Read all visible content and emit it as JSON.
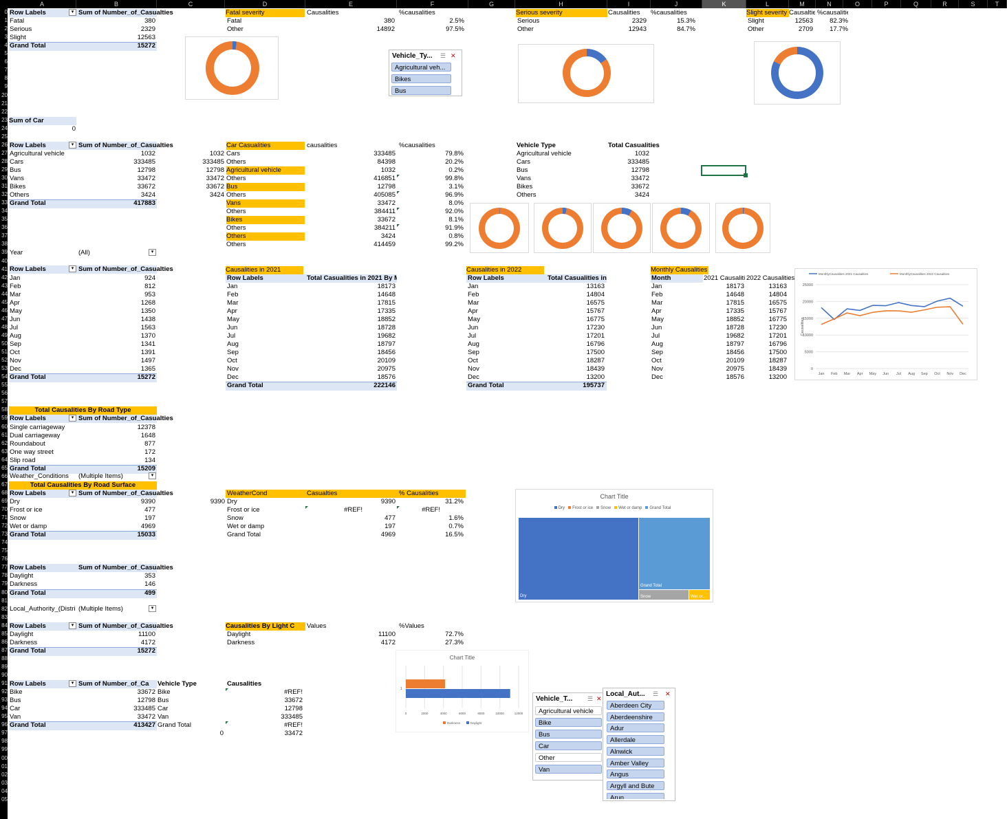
{
  "columns": [
    "A",
    "B",
    "C",
    "D",
    "E",
    "F",
    "G",
    "H",
    "I",
    "J",
    "K",
    "L",
    "M",
    "N",
    "O",
    "P",
    "Q",
    "R",
    "S",
    "T"
  ],
  "selected_column": "K",
  "row_numbers": [
    "0",
    "1",
    "2",
    "3",
    "4",
    "5",
    "6",
    "7",
    "8",
    "9",
    "20",
    "21",
    "22",
    "23",
    "24",
    "25",
    "26",
    "27",
    "28",
    "29",
    "30",
    "31",
    "32",
    "33",
    "34",
    "35",
    "36",
    "37",
    "38",
    "39",
    "40",
    "41",
    "42",
    "43",
    "44",
    "45",
    "46",
    "47",
    "48",
    "49",
    "50",
    "51",
    "52",
    "53",
    "54",
    "55",
    "56",
    "57",
    "58",
    "59",
    "60",
    "61",
    "62",
    "63",
    "64",
    "65",
    "66",
    "67",
    "68",
    "69",
    "70",
    "71",
    "72",
    "73",
    "74",
    "75",
    "76",
    "77",
    "78",
    "79",
    "80",
    "81",
    "82",
    "83",
    "84",
    "85",
    "86",
    "87",
    "88",
    "89",
    "90",
    "91",
    "92",
    "93",
    "94",
    "95",
    "96",
    "97",
    "98",
    "99",
    "00",
    "01",
    "02",
    "03",
    "04",
    "05"
  ],
  "severity_pivot": {
    "h1": "Row Labels",
    "h2": "Sum of Number_of_Casualties",
    "rows": [
      [
        "Fatal",
        "380"
      ],
      [
        "Serious",
        "2329"
      ],
      [
        "Slight",
        "12563"
      ]
    ],
    "total": [
      "Grand Total",
      "15272"
    ]
  },
  "fatal": {
    "h": [
      "Fatal severity",
      "Causalities",
      "%causalities"
    ],
    "rows": [
      [
        "Fatal",
        "380",
        "2.5%"
      ],
      [
        "Other",
        "14892",
        "97.5%"
      ]
    ]
  },
  "serious": {
    "h": [
      "Serious severity",
      "Causalities",
      "%causalities"
    ],
    "rows": [
      [
        "Serious",
        "2329",
        "15.3%"
      ],
      [
        "Other",
        "12943",
        "84.7%"
      ]
    ]
  },
  "slight": {
    "h": [
      "Slight severity",
      "Causaltie",
      "%causalities"
    ],
    "rows": [
      [
        "Slight",
        "12563",
        "82.3%"
      ],
      [
        "Other",
        "2709",
        "17.7%"
      ]
    ]
  },
  "sum_car": {
    "label": "Sum of Car",
    "value": "0"
  },
  "vehicle_pivot": {
    "h1": "Row Labels",
    "h2": "Sum of Number_of_Casualties",
    "rows": [
      [
        "Agricultural vehicle",
        "1032"
      ],
      [
        "Cars",
        "333485"
      ],
      [
        "Bus",
        "12798"
      ],
      [
        "Vans",
        "33472"
      ],
      [
        "Bikes",
        "33672"
      ],
      [
        "Others",
        "3424"
      ]
    ],
    "total": [
      "Grand Total",
      "417883"
    ]
  },
  "colC_values": [
    "1032",
    "333485",
    "12798",
    "33472",
    "33672",
    "3424"
  ],
  "car_casualties": {
    "h": [
      "Car Casualities",
      "causalities",
      "%causalities"
    ],
    "rows": [
      [
        "Cars",
        "333485",
        "79.8%"
      ],
      [
        "Others",
        "84398",
        "20.2%"
      ],
      [
        "Agricultural vehicle",
        "1032",
        "0.2%"
      ],
      [
        "Others",
        "416851",
        "99.8%"
      ],
      [
        "Bus",
        "12798",
        "3.1%"
      ],
      [
        "Others",
        "405085",
        "96.9%"
      ],
      [
        "Vans",
        "33472",
        "8.0%"
      ],
      [
        "Others",
        "384411",
        "92.0%"
      ],
      [
        "Bikes",
        "33672",
        "8.1%"
      ],
      [
        "Others",
        "384211",
        "91.9%"
      ],
      [
        "Others",
        "3424",
        "0.8%"
      ],
      [
        "Others",
        "414459",
        "99.2%"
      ]
    ]
  },
  "vehicle_type_table": {
    "h": [
      "Vehicle Type",
      "Total Casualities"
    ],
    "rows": [
      [
        "Agricultural vehicle",
        "1032"
      ],
      [
        "Cars",
        "333485"
      ],
      [
        "Bus",
        "12798"
      ],
      [
        "Vans",
        "33472"
      ],
      [
        "Bikes",
        "33672"
      ],
      [
        "Others",
        "3424"
      ]
    ]
  },
  "donut_pcts": {
    "fatal": 2.5,
    "serious": 15.3,
    "slight": 82.3,
    "v1": 0.2,
    "v2": 3.1,
    "v3": 8.0,
    "v4": 8.1,
    "v5": 0.8
  },
  "year_filter": {
    "label": "Year",
    "value": "(All)"
  },
  "month_pivot": {
    "h1": "Row Labels",
    "h2": "Sum of Number_of_Casualties",
    "rows": [
      [
        "Jan",
        "924"
      ],
      [
        "Feb",
        "812"
      ],
      [
        "Mar",
        "953"
      ],
      [
        "Apr",
        "1268"
      ],
      [
        "May",
        "1350"
      ],
      [
        "Jun",
        "1438"
      ],
      [
        "Jul",
        "1563"
      ],
      [
        "Aug",
        "1370"
      ],
      [
        "Sep",
        "1341"
      ],
      [
        "Oct",
        "1391"
      ],
      [
        "Nov",
        "1497"
      ],
      [
        "Dec",
        "1365"
      ]
    ],
    "total": [
      "Grand Total",
      "15272"
    ]
  },
  "cas2021": {
    "title": "Causalities in 2021",
    "h1": "Row Labels",
    "h2": "Total Casualities in 2021 By Month",
    "rows": [
      [
        "Jan",
        "18173"
      ],
      [
        "Feb",
        "14648"
      ],
      [
        "Mar",
        "17815"
      ],
      [
        "Apr",
        "17335"
      ],
      [
        "May",
        "18852"
      ],
      [
        "Jun",
        "18728"
      ],
      [
        "Jul",
        "19682"
      ],
      [
        "Aug",
        "18797"
      ],
      [
        "Sep",
        "18456"
      ],
      [
        "Oct",
        "20109"
      ],
      [
        "Nov",
        "20975"
      ],
      [
        "Dec",
        "18576"
      ]
    ],
    "total": [
      "Grand Total",
      "222146"
    ]
  },
  "cas2022": {
    "title": "Causalities in 2022",
    "h1": "Row Labels",
    "h2": "Total Casualities in 2022 By Month",
    "rows": [
      [
        "Jan",
        "13163"
      ],
      [
        "Feb",
        "14804"
      ],
      [
        "Mar",
        "16575"
      ],
      [
        "Apr",
        "15767"
      ],
      [
        "May",
        "16775"
      ],
      [
        "Jun",
        "17230"
      ],
      [
        "Jul",
        "17201"
      ],
      [
        "Aug",
        "16796"
      ],
      [
        "Sep",
        "17500"
      ],
      [
        "Oct",
        "18287"
      ],
      [
        "Nov",
        "18439"
      ],
      [
        "Dec",
        "13200"
      ]
    ],
    "total": [
      "Grand Total",
      "195737"
    ]
  },
  "monthly": {
    "title": "Monthly Causalities",
    "h": [
      "Month",
      "2021 Causaliti",
      "2022 Causalities"
    ],
    "rows": [
      [
        "Jan",
        "18173",
        "13163"
      ],
      [
        "Feb",
        "14648",
        "14804"
      ],
      [
        "Mar",
        "17815",
        "16575"
      ],
      [
        "Apr",
        "17335",
        "15767"
      ],
      [
        "May",
        "18852",
        "16775"
      ],
      [
        "Jun",
        "18728",
        "17230"
      ],
      [
        "Jul",
        "19682",
        "17201"
      ],
      [
        "Aug",
        "18797",
        "16796"
      ],
      [
        "Sep",
        "18456",
        "17500"
      ],
      [
        "Oct",
        "20109",
        "18287"
      ],
      [
        "Nov",
        "20975",
        "18439"
      ],
      [
        "Dec",
        "18576",
        "13200"
      ]
    ]
  },
  "road_type": {
    "title": "Total Causalities By Road Type",
    "h1": "Row Labels",
    "h2": "Sum of Number_of_Casualties",
    "rows": [
      [
        "Single carriageway",
        "12378"
      ],
      [
        "Dual carriageway",
        "1648"
      ],
      [
        "Roundabout",
        "877"
      ],
      [
        "One way street",
        "172"
      ],
      [
        "Slip road",
        "134"
      ]
    ],
    "total": [
      "Grand Total",
      "15209"
    ]
  },
  "weather_filter": {
    "label": "Weather_Conditions",
    "value": "(Multiple Items)"
  },
  "road_surface": {
    "title": "Total Causalities By Road Surface",
    "h1": "Row Labels",
    "h2": "Sum of Number_of_Casualties",
    "rows": [
      [
        "Dry",
        "9390"
      ],
      [
        "Frost or ice",
        "477"
      ],
      [
        "Snow",
        "197"
      ],
      [
        "Wet or damp",
        "4969"
      ]
    ],
    "total": [
      "Grand Total",
      "15033"
    ]
  },
  "colC_dry": "9390",
  "weather_table": {
    "h": [
      "WeatherCond",
      "Casualties",
      "% Causalities"
    ],
    "rows": [
      [
        "Dry",
        "9390",
        "31.2%"
      ],
      [
        "Frost or ice",
        "#REF!",
        "#REF!"
      ],
      [
        "Snow",
        "477",
        "1.6%"
      ],
      [
        "Wet or damp",
        "197",
        "0.7%"
      ],
      [
        "Grand Total",
        "4969",
        "16.5%"
      ]
    ]
  },
  "light_pivot1": {
    "h1": "Row Labels",
    "h2": "Sum of Number_of_Casualties",
    "rows": [
      [
        "Daylight",
        "353"
      ],
      [
        "Darkness",
        "146"
      ]
    ],
    "total": [
      "Grand Total",
      "499"
    ]
  },
  "local_filter": {
    "label": "Local_Authority_(Distri",
    "value": "(Multiple Items)"
  },
  "light_pivot2": {
    "h1": "Row Labels",
    "h2": "Sum of Number_of_Casualties",
    "rows": [
      [
        "Daylight",
        "11100"
      ],
      [
        "Darkness",
        "4172"
      ]
    ],
    "total": [
      "Grand Total",
      "15272"
    ]
  },
  "light_table": {
    "h": [
      "Causalities By Light C",
      "Values",
      "%Values"
    ],
    "rows": [
      [
        "Daylight",
        "11100",
        "72.7%"
      ],
      [
        "Darkness",
        "4172",
        "27.3%"
      ]
    ]
  },
  "veh_pivot2": {
    "h1": "Row Labels",
    "h2": "Sum of Number_of_Ca",
    "rows": [
      [
        "Bike",
        "33672"
      ],
      [
        "Bus",
        "12798"
      ],
      [
        "Car",
        "333485"
      ],
      [
        "Van",
        "33472"
      ]
    ],
    "total": [
      "Grand Total",
      "413427"
    ]
  },
  "veh_col_c": {
    "h": "Vehicle Type",
    "rows": [
      "Bike",
      "Bus",
      "Car",
      "Van",
      "Grand Total"
    ]
  },
  "veh_col_d": {
    "h": "Causalities",
    "rows": [
      "#REF!",
      "33672",
      "12798",
      "333485",
      "#REF!",
      "33472"
    ]
  },
  "zero_cell": "0",
  "slicer_vehicle_top": {
    "title": "Vehicle_Ty...",
    "items": [
      "Agricultural veh...",
      "Bikes",
      "Bus"
    ]
  },
  "slicer_vehicle": {
    "title": "Vehicle_T...",
    "items": [
      "Agricultural vehicle",
      "Bike",
      "Bus",
      "Car",
      "Other",
      "Van"
    ],
    "selected": [
      false,
      true,
      true,
      true,
      false,
      true
    ]
  },
  "slicer_local": {
    "title": "Local_Aut...",
    "items": [
      "Aberdeen City",
      "Aberdeenshire",
      "Adur",
      "Allerdale",
      "Alnwick",
      "Amber Valley",
      "Angus",
      "Argyll and Bute",
      "Arun"
    ]
  },
  "line_chart": {
    "legend": [
      "MonthlyCausalities 2021 Causalities",
      "MonthlyCausalities 2022 Causalities"
    ],
    "ylabel": "Causalities",
    "yticks": [
      "25000",
      "20000",
      "15000",
      "10000",
      "5000",
      "0"
    ]
  },
  "treemap": {
    "title": "Chart Title",
    "legend": [
      "Dry",
      "Frost or ice",
      "Snow",
      "Wet or damp",
      "Grand Total"
    ],
    "labels": [
      "Dry",
      "Grand Total",
      "Snow",
      "Wet or..."
    ]
  },
  "bar_chart": {
    "title": "Chart Title",
    "category": "1",
    "xticks": [
      "0",
      "2000",
      "4000",
      "6000",
      "8000",
      "10000",
      "12000"
    ],
    "legend": [
      "Darkness",
      "Daylight"
    ]
  },
  "colors": {
    "orange": "#ed7d31",
    "blue": "#4472c4",
    "gold": "#ffc000",
    "lightblue": "#5b9bd5",
    "gray": "#a5a5a5",
    "pivot": "#dde6f5"
  },
  "chart_data": [
    {
      "type": "pie",
      "categories": [
        "Fatal",
        "Other"
      ],
      "values": [
        380,
        14892
      ]
    },
    {
      "type": "pie",
      "categories": [
        "Serious",
        "Other"
      ],
      "values": [
        2329,
        12943
      ]
    },
    {
      "type": "pie",
      "categories": [
        "Slight",
        "Other"
      ],
      "values": [
        12563,
        2709
      ]
    },
    {
      "type": "line",
      "x": [
        "Jan",
        "Feb",
        "Mar",
        "Apr",
        "May",
        "Jun",
        "Jul",
        "Aug",
        "Sep",
        "Oct",
        "Nov",
        "Dec"
      ],
      "series": [
        {
          "name": "MonthlyCausalities 2021 Causalities",
          "values": [
            18173,
            14648,
            17815,
            17335,
            18852,
            18728,
            19682,
            18797,
            18456,
            20109,
            20975,
            18576
          ]
        },
        {
          "name": "MonthlyCausalities 2022 Causalities",
          "values": [
            13163,
            14804,
            16575,
            15767,
            16775,
            17230,
            17201,
            16796,
            17500,
            18287,
            18439,
            13200
          ]
        }
      ],
      "ylim": [
        0,
        25000
      ],
      "ylabel": "Causalities"
    },
    {
      "type": "bar",
      "categories": [
        "1"
      ],
      "series": [
        {
          "name": "Darkness",
          "values": [
            4172
          ]
        },
        {
          "name": "Daylight",
          "values": [
            11100
          ]
        }
      ],
      "xlim": [
        0,
        12000
      ],
      "title": "Chart Title"
    }
  ]
}
